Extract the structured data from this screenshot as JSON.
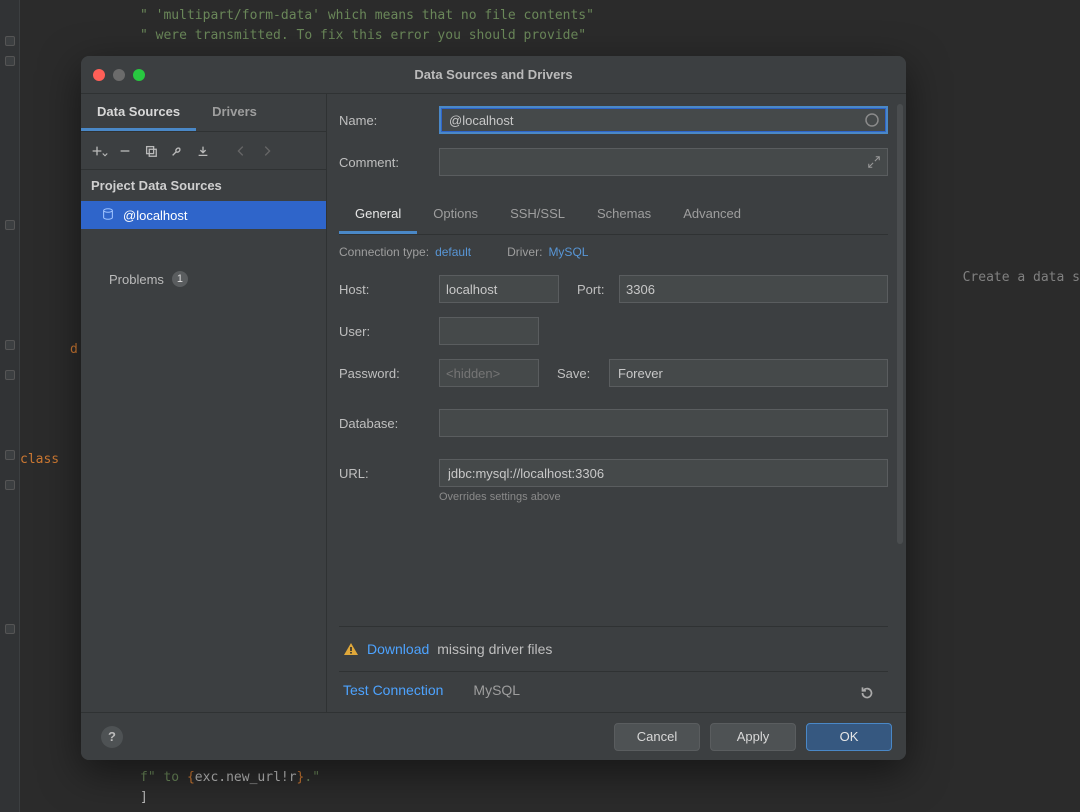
{
  "bg_code": {
    "line1": "\" 'multipart/form-data' which means that no file contents\"",
    "line2": "\" were transmitted. To fix this error you should provide\"",
    "d1": "d",
    "class_kw": "class",
    "bottom_plain": "f\" to ",
    "bottom_brace_open": "{",
    "bottom_expr": "exc.new_url!r",
    "bottom_brace_close": "}",
    "bottom_after": ".\"",
    "bottom_bracket": "]"
  },
  "bg_right": "Create a data s",
  "dialog": {
    "title": "Data Sources and Drivers",
    "left_tabs": [
      "Data Sources",
      "Drivers"
    ],
    "active_left_tab": 0,
    "tree_header": "Project Data Sources",
    "tree_selected": "@localhost",
    "problems_label": "Problems",
    "problems_count": "1"
  },
  "form": {
    "name_label": "Name:",
    "name_value": "@localhost",
    "comment_label": "Comment:",
    "config_tabs": [
      "General",
      "Options",
      "SSH/SSL",
      "Schemas",
      "Advanced"
    ],
    "active_config_tab": 0,
    "conn_type_label": "Connection type:",
    "conn_type_value": "default",
    "driver_label": "Driver:",
    "driver_value": "MySQL",
    "host_label": "Host:",
    "host_value": "localhost",
    "port_label": "Port:",
    "port_value": "3306",
    "user_label": "User:",
    "user_value": "",
    "password_label": "Password:",
    "password_placeholder": "<hidden>",
    "save_label": "Save:",
    "save_value": "Forever",
    "database_label": "Database:",
    "database_value": "",
    "url_label": "URL:",
    "url_value": "jdbc:mysql://localhost:3306",
    "url_hint": "Overrides settings above"
  },
  "footer": {
    "download_link": "Download",
    "download_rest": "missing driver files",
    "test_connection": "Test Connection",
    "driver_name": "MySQL",
    "cancel": "Cancel",
    "apply": "Apply",
    "ok": "OK"
  }
}
